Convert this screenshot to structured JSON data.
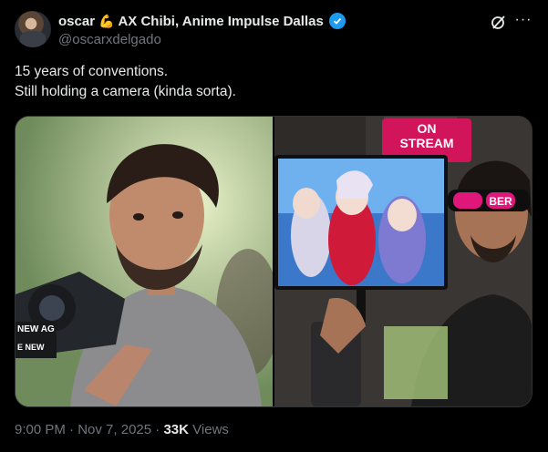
{
  "author": {
    "name": "oscar",
    "emoji": "💪",
    "display_suffix": "AX Chibi, Anime Impulse Dallas",
    "handle": "@oscarxdelgado",
    "verified": true
  },
  "tweet": {
    "line1": "15 years of conventions.",
    "line2": "Still holding a camera (kinda sorta)."
  },
  "media": {
    "photo_left": {
      "subject": "young man holding a DSLR camera",
      "strap_text": "NEW AG",
      "strap_text2": "E NEW"
    },
    "photo_right": {
      "subject": "man with VTuber monitor rig",
      "sign_line1": "ON",
      "sign_line2": "STREAM",
      "glasses_text": "BER",
      "accent_sign": "#d2155b",
      "accent_glasses": "#e0177a"
    }
  },
  "meta": {
    "time": "9:00 PM",
    "separator": "·",
    "date": "Nov 7, 2025",
    "views_count": "33K",
    "views_label": "Views"
  },
  "colors": {
    "background": "#000000",
    "text_primary": "#e7e9ea",
    "text_secondary": "#71767b",
    "verified": "#1d9bf0",
    "border": "#2f3336"
  }
}
